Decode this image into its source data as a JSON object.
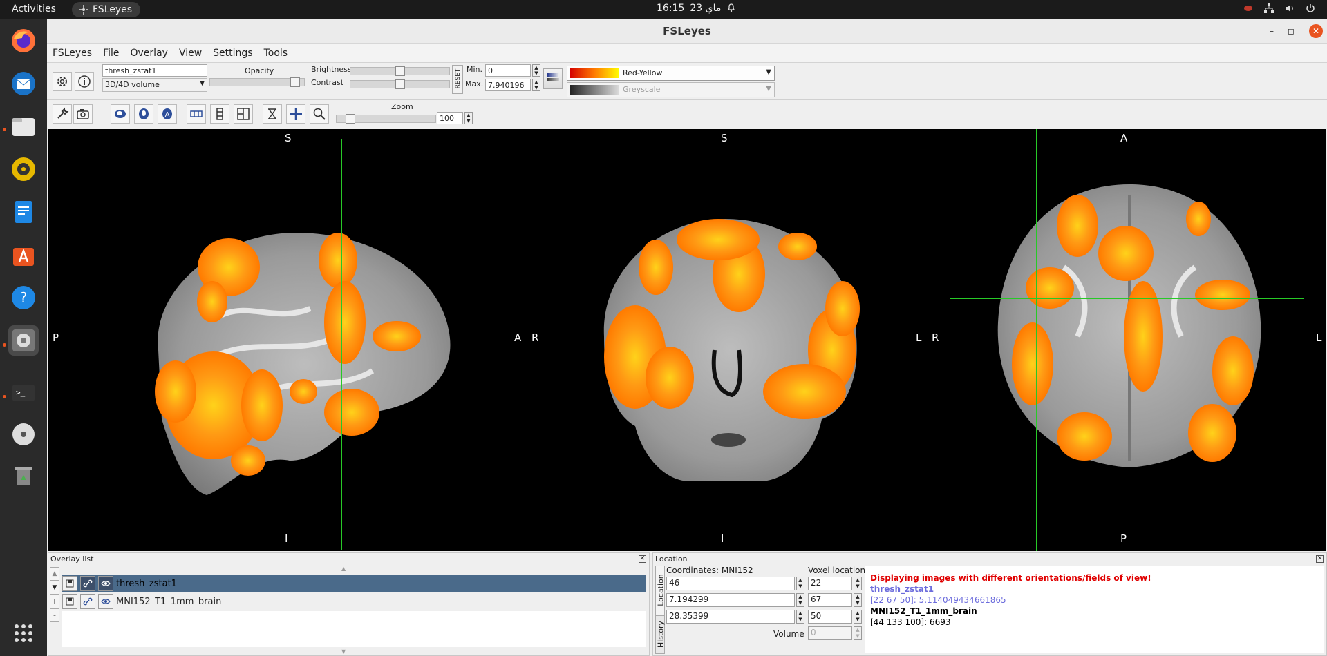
{
  "topbar": {
    "activities": "Activities",
    "app_name": "FSLeyes",
    "time": "16:15",
    "date": "23 ماي"
  },
  "window": {
    "title": "FSLeyes"
  },
  "menu": [
    "FSLeyes",
    "File",
    "Overlay",
    "View",
    "Settings",
    "Tools"
  ],
  "overlay_toolbar": {
    "overlay_name": "thresh_zstat1",
    "overlay_type": "3D/4D volume",
    "opacity_label": "Opacity",
    "brightness_label": "Brightness",
    "contrast_label": "Contrast",
    "reset_label": "RESET",
    "min_label": "Min.",
    "max_label": "Max.",
    "min_value": "0",
    "max_value": "7.940196",
    "colormap": "Red-Yellow",
    "neg_colormap": "Greyscale",
    "opacity_level": 0.95,
    "brightness_level": 0.5,
    "contrast_level": 0.5
  },
  "view_toolbar": {
    "zoom_label": "Zoom",
    "zoom_value": "100",
    "zoom_level": 0.1
  },
  "ortho": {
    "sagittal": {
      "top": "S",
      "bottom": "I",
      "left": "P",
      "right": "A"
    },
    "coronal": {
      "top": "S",
      "bottom": "I",
      "left": "R",
      "right": "L"
    },
    "axial": {
      "top": "A",
      "bottom": "P",
      "left": "R",
      "right": "L"
    }
  },
  "overlay_list": {
    "title": "Overlay list",
    "items": [
      {
        "name": "thresh_zstat1",
        "selected": true
      },
      {
        "name": "MNI152_T1_1mm_brain",
        "selected": false
      }
    ]
  },
  "location": {
    "title": "Location",
    "coords_label": "Coordinates: MNI152",
    "voxel_label": "Voxel location",
    "tab_location": "Location",
    "tab_history": "History",
    "x": "46",
    "y": "7.194299",
    "z": "28.35399",
    "vx": "22",
    "vy": "67",
    "vz": "50",
    "volume_label": "Volume",
    "volume": "0",
    "warning": "Displaying images with different orientations/fields of view!",
    "ov1_name": "thresh_zstat1",
    "ov1_value": "[22 67 50]: 5.114049434661865",
    "ov2_name": "MNI152_T1_1mm_brain",
    "ov2_value": "[44 133 100]: 6693"
  },
  "colors": {
    "cursor": "#27c927",
    "warning": "#e00000",
    "overlay_info": "#6b6bdc",
    "selection": "#4a6a8a"
  }
}
